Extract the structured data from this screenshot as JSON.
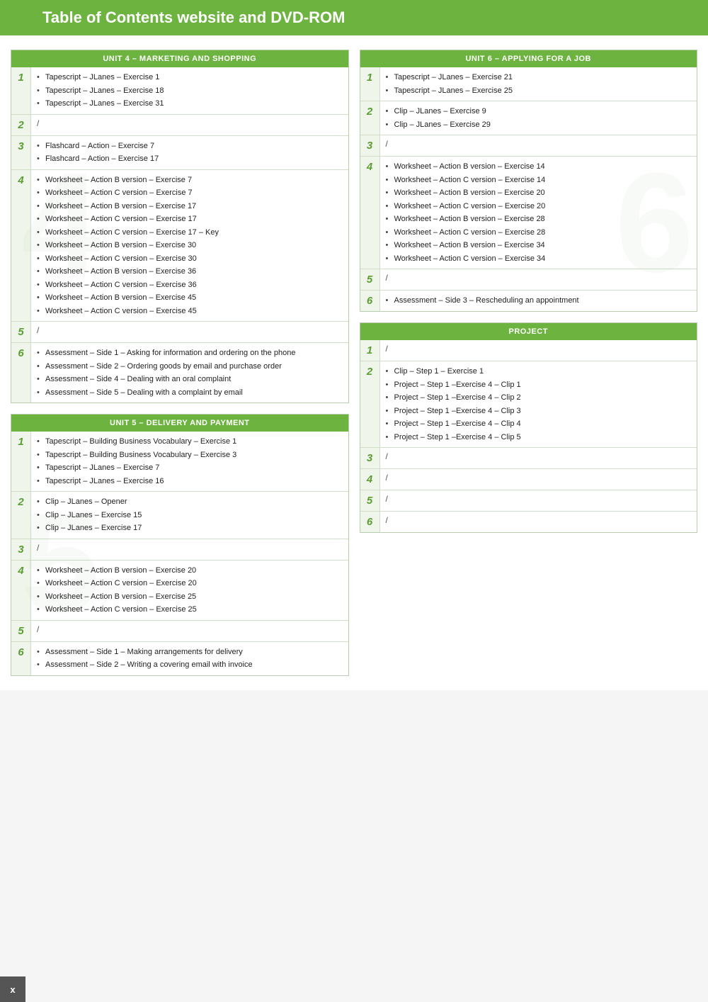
{
  "header": {
    "title": "Table of Contents website and DVD-ROM"
  },
  "unit4": {
    "header": "UNIT 4 – MARKETING AND SHOPPING",
    "rows": [
      {
        "num": "1",
        "items": [
          "Tapescript – JLanes – Exercise 1",
          "Tapescript – JLanes – Exercise 18",
          "Tapescript – JLanes – Exercise 31"
        ]
      },
      {
        "num": "2",
        "slash": "/"
      },
      {
        "num": "3",
        "items": [
          "Flashcard – Action – Exercise 7",
          "Flashcard – Action – Exercise 17"
        ]
      },
      {
        "num": "4",
        "items": [
          "Worksheet – Action B version – Exercise 7",
          "Worksheet – Action C version – Exercise 7",
          "Worksheet – Action B version – Exercise 17",
          "Worksheet – Action C version – Exercise 17",
          "Worksheet – Action C version – Exercise 17 – Key",
          "Worksheet – Action B version – Exercise 30",
          "Worksheet – Action C version – Exercise 30",
          "Worksheet – Action B version – Exercise 36",
          "Worksheet – Action C version – Exercise 36",
          "Worksheet – Action B version – Exercise 45",
          "Worksheet – Action C version – Exercise 45"
        ]
      },
      {
        "num": "5",
        "slash": "/"
      },
      {
        "num": "6",
        "items": [
          "Assessment – Side 1 – Asking for information and ordering on the phone",
          "Assessment – Side 2 – Ordering goods by email and purchase order",
          "Assessment – Side 4 – Dealing with an oral complaint",
          "Assessment – Side 5 – Dealing with a complaint by email"
        ]
      }
    ]
  },
  "unit5": {
    "header": "UNIT 5 – DELIVERY AND PAYMENT",
    "rows": [
      {
        "num": "1",
        "items": [
          "Tapescript – Building Business Vocabulary – Exercise 1",
          "Tapescript – Building Business Vocabulary – Exercise 3",
          "Tapescript – JLanes – Exercise 7",
          "Tapescript – JLanes – Exercise 16"
        ]
      },
      {
        "num": "2",
        "items": [
          "Clip – JLanes – Opener",
          "Clip – JLanes – Exercise 15",
          "Clip – JLanes – Exercise 17"
        ]
      },
      {
        "num": "3",
        "slash": "/"
      },
      {
        "num": "4",
        "items": [
          "Worksheet – Action B version – Exercise 20",
          "Worksheet – Action C version – Exercise 20",
          "Worksheet – Action B version – Exercise 25",
          "Worksheet – Action C version – Exercise 25"
        ]
      },
      {
        "num": "5",
        "slash": "/"
      },
      {
        "num": "6",
        "items": [
          "Assessment – Side 1 – Making arrangements for delivery",
          "Assessment – Side 2 – Writing a covering email with invoice"
        ]
      }
    ]
  },
  "unit6": {
    "header": "UNIT 6 – APPLYING FOR A JOB",
    "rows": [
      {
        "num": "1",
        "items": [
          "Tapescript – JLanes – Exercise 21",
          "Tapescript – JLanes – Exercise 25"
        ]
      },
      {
        "num": "2",
        "items": [
          "Clip – JLanes – Exercise 9",
          "Clip – JLanes – Exercise 29"
        ]
      },
      {
        "num": "3",
        "slash": "/"
      },
      {
        "num": "4",
        "items": [
          "Worksheet – Action B version – Exercise 14",
          "Worksheet – Action C version – Exercise 14",
          "Worksheet – Action B version – Exercise 20",
          "Worksheet – Action C version – Exercise 20",
          "Worksheet – Action B version – Exercise 28",
          "Worksheet – Action C version – Exercise 28",
          "Worksheet – Action B version – Exercise 34",
          "Worksheet – Action C version – Exercise 34"
        ]
      },
      {
        "num": "5",
        "slash": "/"
      },
      {
        "num": "6",
        "items": [
          "Assessment – Side 3 – Rescheduling an appointment"
        ]
      }
    ]
  },
  "project": {
    "header": "PROJECT",
    "rows": [
      {
        "num": "1",
        "slash": "/"
      },
      {
        "num": "2",
        "items": [
          "Clip – Step 1 – Exercise 1",
          "Project – Step 1 –Exercise 4 – Clip 1",
          "Project – Step 1 –Exercise 4 – Clip 2",
          "Project – Step 1 –Exercise 4 – Clip 3",
          "Project – Step 1 –Exercise 4 – Clip 4",
          "Project – Step 1 –Exercise 4 – Clip 5"
        ]
      },
      {
        "num": "3",
        "slash": "/"
      },
      {
        "num": "4",
        "slash": "/"
      },
      {
        "num": "5",
        "slash": "/"
      },
      {
        "num": "6",
        "slash": "/"
      }
    ]
  },
  "footer": {
    "page": "x"
  }
}
